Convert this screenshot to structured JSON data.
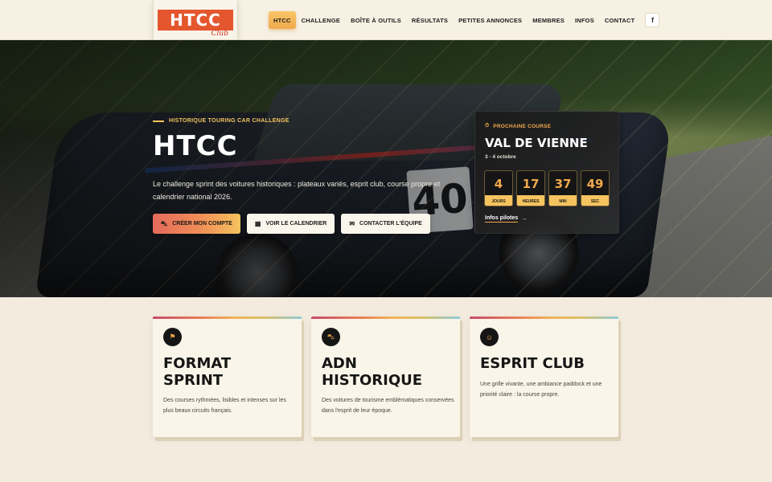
{
  "header": {
    "logo_text": "HTCC",
    "logo_script": "Club",
    "nav": [
      {
        "label": "HTCC",
        "active": true
      },
      {
        "label": "Challenge",
        "active": false
      },
      {
        "label": "Boîte à outils",
        "active": false
      },
      {
        "label": "Résultats",
        "active": false
      },
      {
        "label": "Petites annonces",
        "active": false
      },
      {
        "label": "Membres",
        "active": false
      },
      {
        "label": "Infos",
        "active": false
      },
      {
        "label": "Contact",
        "active": false
      }
    ],
    "facebook_icon": "f"
  },
  "hero": {
    "eyebrow": "HISTORIQUE TOURING CAR CHALLENGE",
    "title": "HTCC",
    "description": "Le challenge sprint des voitures historiques : plateaux variés, esprit club, course propre et calendrier national 2026.",
    "buttons": {
      "create_account": "CRÉER MON COMPTE",
      "calendar": "VOIR LE CALENDRIER",
      "contact": "CONTACTER L'ÉQUIPE"
    },
    "car_number": "40"
  },
  "next_race": {
    "kicker": "PROCHAINE COURSE",
    "name": "VAL DE VIENNE",
    "date": "3 - 4 octobre",
    "countdown": [
      {
        "value": "4",
        "label": "JOURS"
      },
      {
        "value": "17",
        "label": "HEURES"
      },
      {
        "value": "37",
        "label": "MIN"
      },
      {
        "value": "49",
        "label": "SEC"
      }
    ],
    "link": "Infos pilotes",
    "link_arrow": "→"
  },
  "features": [
    {
      "icon": "flag-icon",
      "title": "FORMAT SPRINT",
      "description": "Des courses rythmées, lisibles et intenses sur les plus beaux circuits français."
    },
    {
      "icon": "car-icon",
      "title": "ADN HISTORIQUE",
      "description": "Des voitures de tourisme emblématiques conservées dans l'esprit de leur époque."
    },
    {
      "icon": "community-icon",
      "title": "ESPRIT CLUB",
      "description": "Une grille vivante, une ambiance paddock et une priorité claire : la course propre."
    }
  ],
  "colors": {
    "accent_orange": "#f0a94c",
    "accent_red": "#e4572e",
    "cream": "#f3ebdd",
    "dark": "#151515"
  }
}
